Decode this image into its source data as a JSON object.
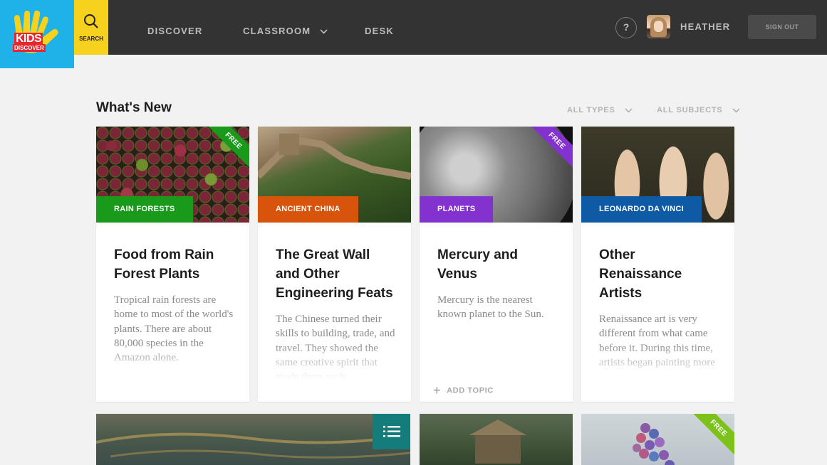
{
  "brand": {
    "logo_line1": "KIDS",
    "logo_line2": "DISCOVER",
    "accent": "#1fb2e8",
    "search_color": "#f6d11d"
  },
  "header": {
    "search_label": "SEARCH",
    "nav": [
      "DISCOVER",
      "CLASSROOM",
      "DESK"
    ],
    "help": "?",
    "username": "HEATHER",
    "signout": "SIGN OUT"
  },
  "section": {
    "title": "What's New",
    "filter_types": "ALL TYPES",
    "filter_subjects": "ALL SUBJECTS"
  },
  "cards": [
    {
      "tag": "RAIN FORESTS",
      "tag_color": "#1a9a1a",
      "free": "FREE",
      "title": "Food from Rain Forest Plants",
      "desc": "Tropical rain forests are home to most of the world's plants. There are about 80,000 species in the Amazon alone."
    },
    {
      "tag": "ANCIENT CHINA",
      "tag_color": "#d9540b",
      "title": "The Great Wall and Other Engineering Feats",
      "desc": "The Chinese turned their skills to building, trade, and travel. They showed the same creative spirit that made them such"
    },
    {
      "tag": "PLANETS",
      "tag_color": "#8332d0",
      "free": "FREE",
      "title": "Mercury and Venus",
      "desc": "Mercury is the nearest known planet to the Sun.",
      "action": "ADD TOPIC"
    },
    {
      "tag": "LEONARDO DA VINCI",
      "tag_color": "#0f5aa5",
      "title": "Other Renaissance Artists",
      "desc": "Renaissance art is very different from what came before it. During this time, artists began painting more"
    }
  ],
  "bottom_cards": [
    {
      "icon": "list-icon"
    },
    {},
    {
      "free": "FREE"
    }
  ]
}
